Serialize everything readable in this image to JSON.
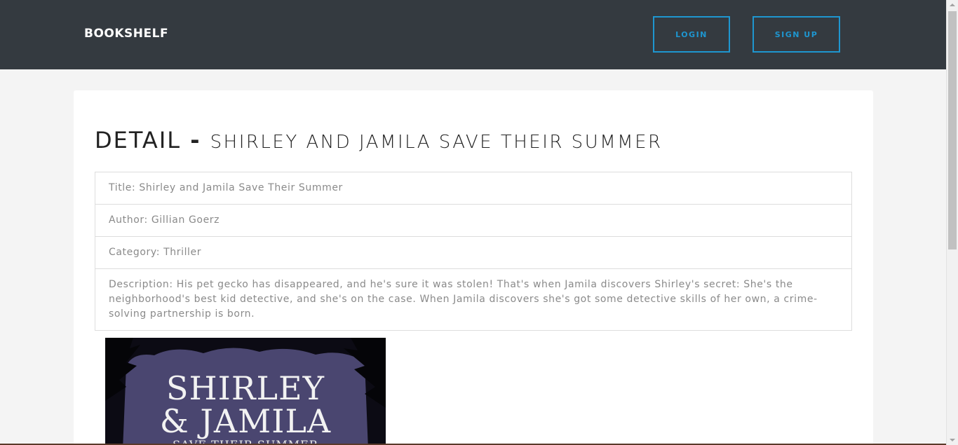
{
  "navbar": {
    "brand": "BOOKSHELF",
    "login_label": "LOGIN",
    "signup_label": "SIGN UP"
  },
  "detail": {
    "heading_main": "DETAIL",
    "heading_sep": "-",
    "heading_sub": "SHIRLEY AND JAMILA SAVE THEIR SUMMER",
    "items": [
      "Title: Shirley and Jamila Save Their Summer",
      "Author: Gillian Goerz",
      "Category: Thriller",
      "Description: His pet gecko has disappeared, and he's sure it was stolen! That's when Jamila discovers Shirley's secret: She's the neighborhood's best kid detective, and she's on the case. When Jamila discovers she's got some detective skills of her own, a crime-solving partnership is born."
    ]
  },
  "cover": {
    "line1": "SHIRLEY",
    "line2": "& JAMILA",
    "line3": "SAVE THEIR SUMMER"
  },
  "colors": {
    "navbar_bg": "#343a40",
    "accent": "#1e96d0",
    "page_bg": "#f4f4f4"
  }
}
